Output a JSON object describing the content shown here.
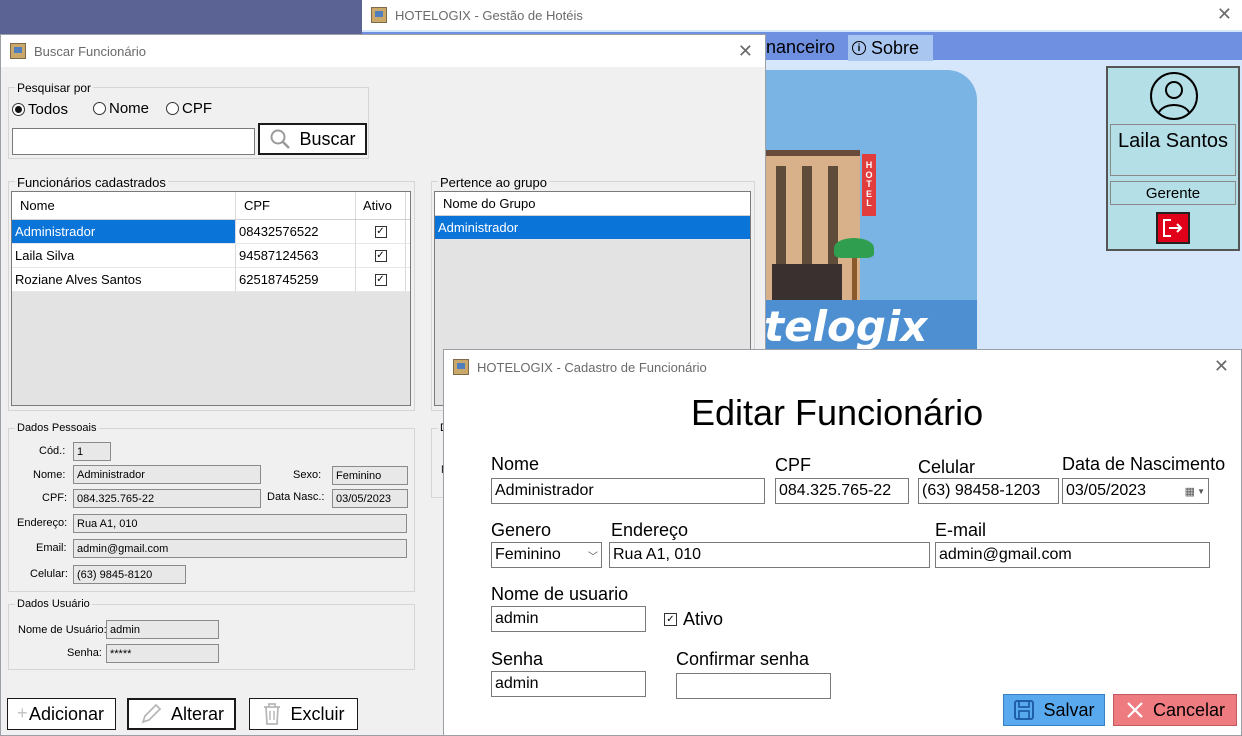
{
  "main_window": {
    "title": "HOTELOGIX - Gestão de Hotéis",
    "menu": {
      "financeiro_label": "nanceiro",
      "sobre_label": "Sobre"
    },
    "user_panel": {
      "name": "Laila Santos",
      "role": "Gerente"
    },
    "logo_text": "telogix",
    "hotel_sign": "HOTEL"
  },
  "buscar": {
    "title": "Buscar Funcionário",
    "search_group_label": "Pesquisar por",
    "radio_options": [
      "Todos",
      "Nome",
      "CPF"
    ],
    "selected_radio": "Todos",
    "search_value": "",
    "search_button_label": "Buscar",
    "employees_group_label": "Funcionários cadastrados",
    "employees_columns": [
      "Nome",
      "CPF",
      "Ativo"
    ],
    "employees_rows": [
      {
        "nome": "Administrador",
        "cpf": "08432576522",
        "ativo": true
      },
      {
        "nome": "Laila Silva",
        "cpf": "94587124563",
        "ativo": true
      },
      {
        "nome": "Roziane Alves Santos",
        "cpf": "62518745259",
        "ativo": true
      }
    ],
    "groups_group_label": "Pertence ao grupo",
    "groups_column": "Nome do Grupo",
    "groups_rows": [
      "Administrador"
    ],
    "personal_group_label": "Dados Pessoais",
    "personal": {
      "cod_label": "Cód.:",
      "cod_value": "1",
      "nome_label": "Nome:",
      "nome_value": "Administrador",
      "sexo_label": "Sexo:",
      "sexo_value": "Feminino",
      "cpf_label": "CPF:",
      "cpf_value": "084.325.765-22",
      "nasc_label": "Data Nasc.:",
      "nasc_value": "03/05/2023",
      "endereco_label": "Endereço:",
      "endereco_value": "Rua A1, 010",
      "email_label": "Email:",
      "email_value": "admin@gmail.com",
      "celular_label": "Celular:",
      "celular_value": "(63) 9845-8120"
    },
    "other_group_label_partial": "D",
    "other_field_label_partial": "N",
    "user_group_label": "Dados Usuário",
    "user": {
      "usuario_label": "Nome de Usuário:",
      "usuario_value": "admin",
      "senha_label": "Senha:",
      "senha_value": "*****"
    },
    "buttons": {
      "adicionar": "Adicionar",
      "alterar": "Alterar",
      "excluir": "Excluir"
    }
  },
  "cadastro": {
    "title": "HOTELOGIX - Cadastro de Funcionário",
    "heading": "Editar Funcionário",
    "fields": {
      "nome_label": "Nome",
      "nome_value": "Administrador",
      "cpf_label": "CPF",
      "cpf_value": "084.325.765-22",
      "celular_label": "Celular",
      "celular_value": "(63) 98458-1203",
      "nasc_label": "Data de Nascimento",
      "nasc_value": "03/05/2023",
      "genero_label": "Genero",
      "genero_value": "Feminino",
      "endereco_label": "Endereço",
      "endereco_value": "Rua A1, 010",
      "email_label": "E-mail",
      "email_value": "admin@gmail.com",
      "usuario_label": "Nome de usuario",
      "usuario_value": "admin",
      "ativo_label": "Ativo",
      "senha_label": "Senha",
      "senha_value": "admin",
      "confirmar_label": "Confirmar senha",
      "confirmar_value": ""
    },
    "buttons": {
      "salvar": "Salvar",
      "cancelar": "Cancelar"
    }
  },
  "colors": {
    "menu_bar": "#6f8fe0",
    "selection": "#0a74d9",
    "user_panel_bg": "#b4dfe6",
    "logout_red": "#e0001a",
    "salvar_bg": "#59a9ee",
    "cancelar_bg": "#ee7b80"
  }
}
